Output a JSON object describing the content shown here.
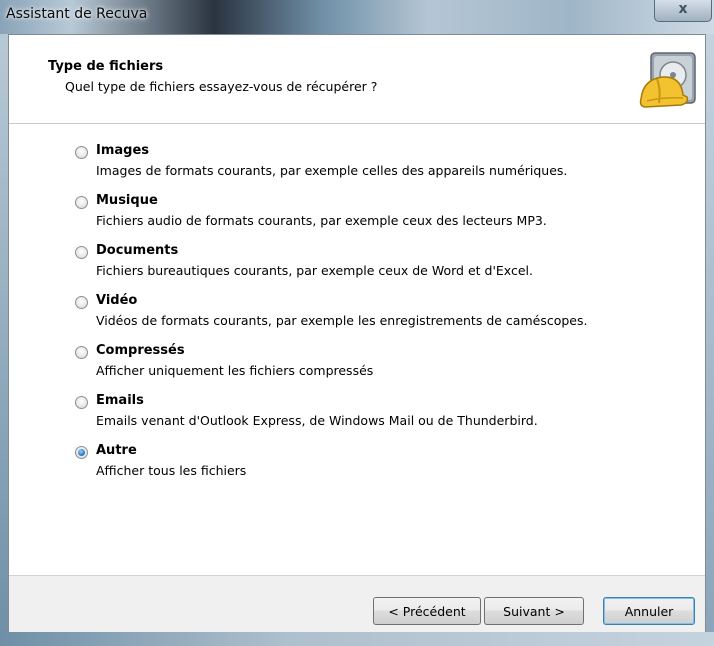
{
  "window": {
    "title": "Assistant de Recuva",
    "close_glyph": "x"
  },
  "header": {
    "title": "Type de fichiers",
    "subtitle": "Quel type de fichiers essayez-vous de récupérer ?",
    "icon": "recuva-hardhat-drive-icon"
  },
  "options": [
    {
      "label": "Images",
      "description": "Images de formats courants, par exemple celles des appareils numériques.",
      "checked": false
    },
    {
      "label": "Musique",
      "description": "Fichiers audio de formats courants, par exemple ceux des lecteurs MP3.",
      "checked": false
    },
    {
      "label": "Documents",
      "description": "Fichiers bureautiques courants, par exemple ceux de Word et d'Excel.",
      "checked": false
    },
    {
      "label": "Vidéo",
      "description": "Vidéos de formats courants, par exemple les enregistrements de caméscopes.",
      "checked": false
    },
    {
      "label": "Compressés",
      "description": "Afficher uniquement les fichiers compressés",
      "checked": false
    },
    {
      "label": "Emails",
      "description": "Emails venant d'Outlook Express, de Windows Mail ou de Thunderbird.",
      "checked": false
    },
    {
      "label": "Autre",
      "description": "Afficher tous les fichiers",
      "checked": true
    }
  ],
  "footer": {
    "back_label": "< Précédent",
    "next_label": "Suivant >",
    "cancel_label": "Annuler"
  },
  "colors": {
    "radio_selected": "#1f6fc4",
    "titlebar": "#6f8fa6"
  }
}
